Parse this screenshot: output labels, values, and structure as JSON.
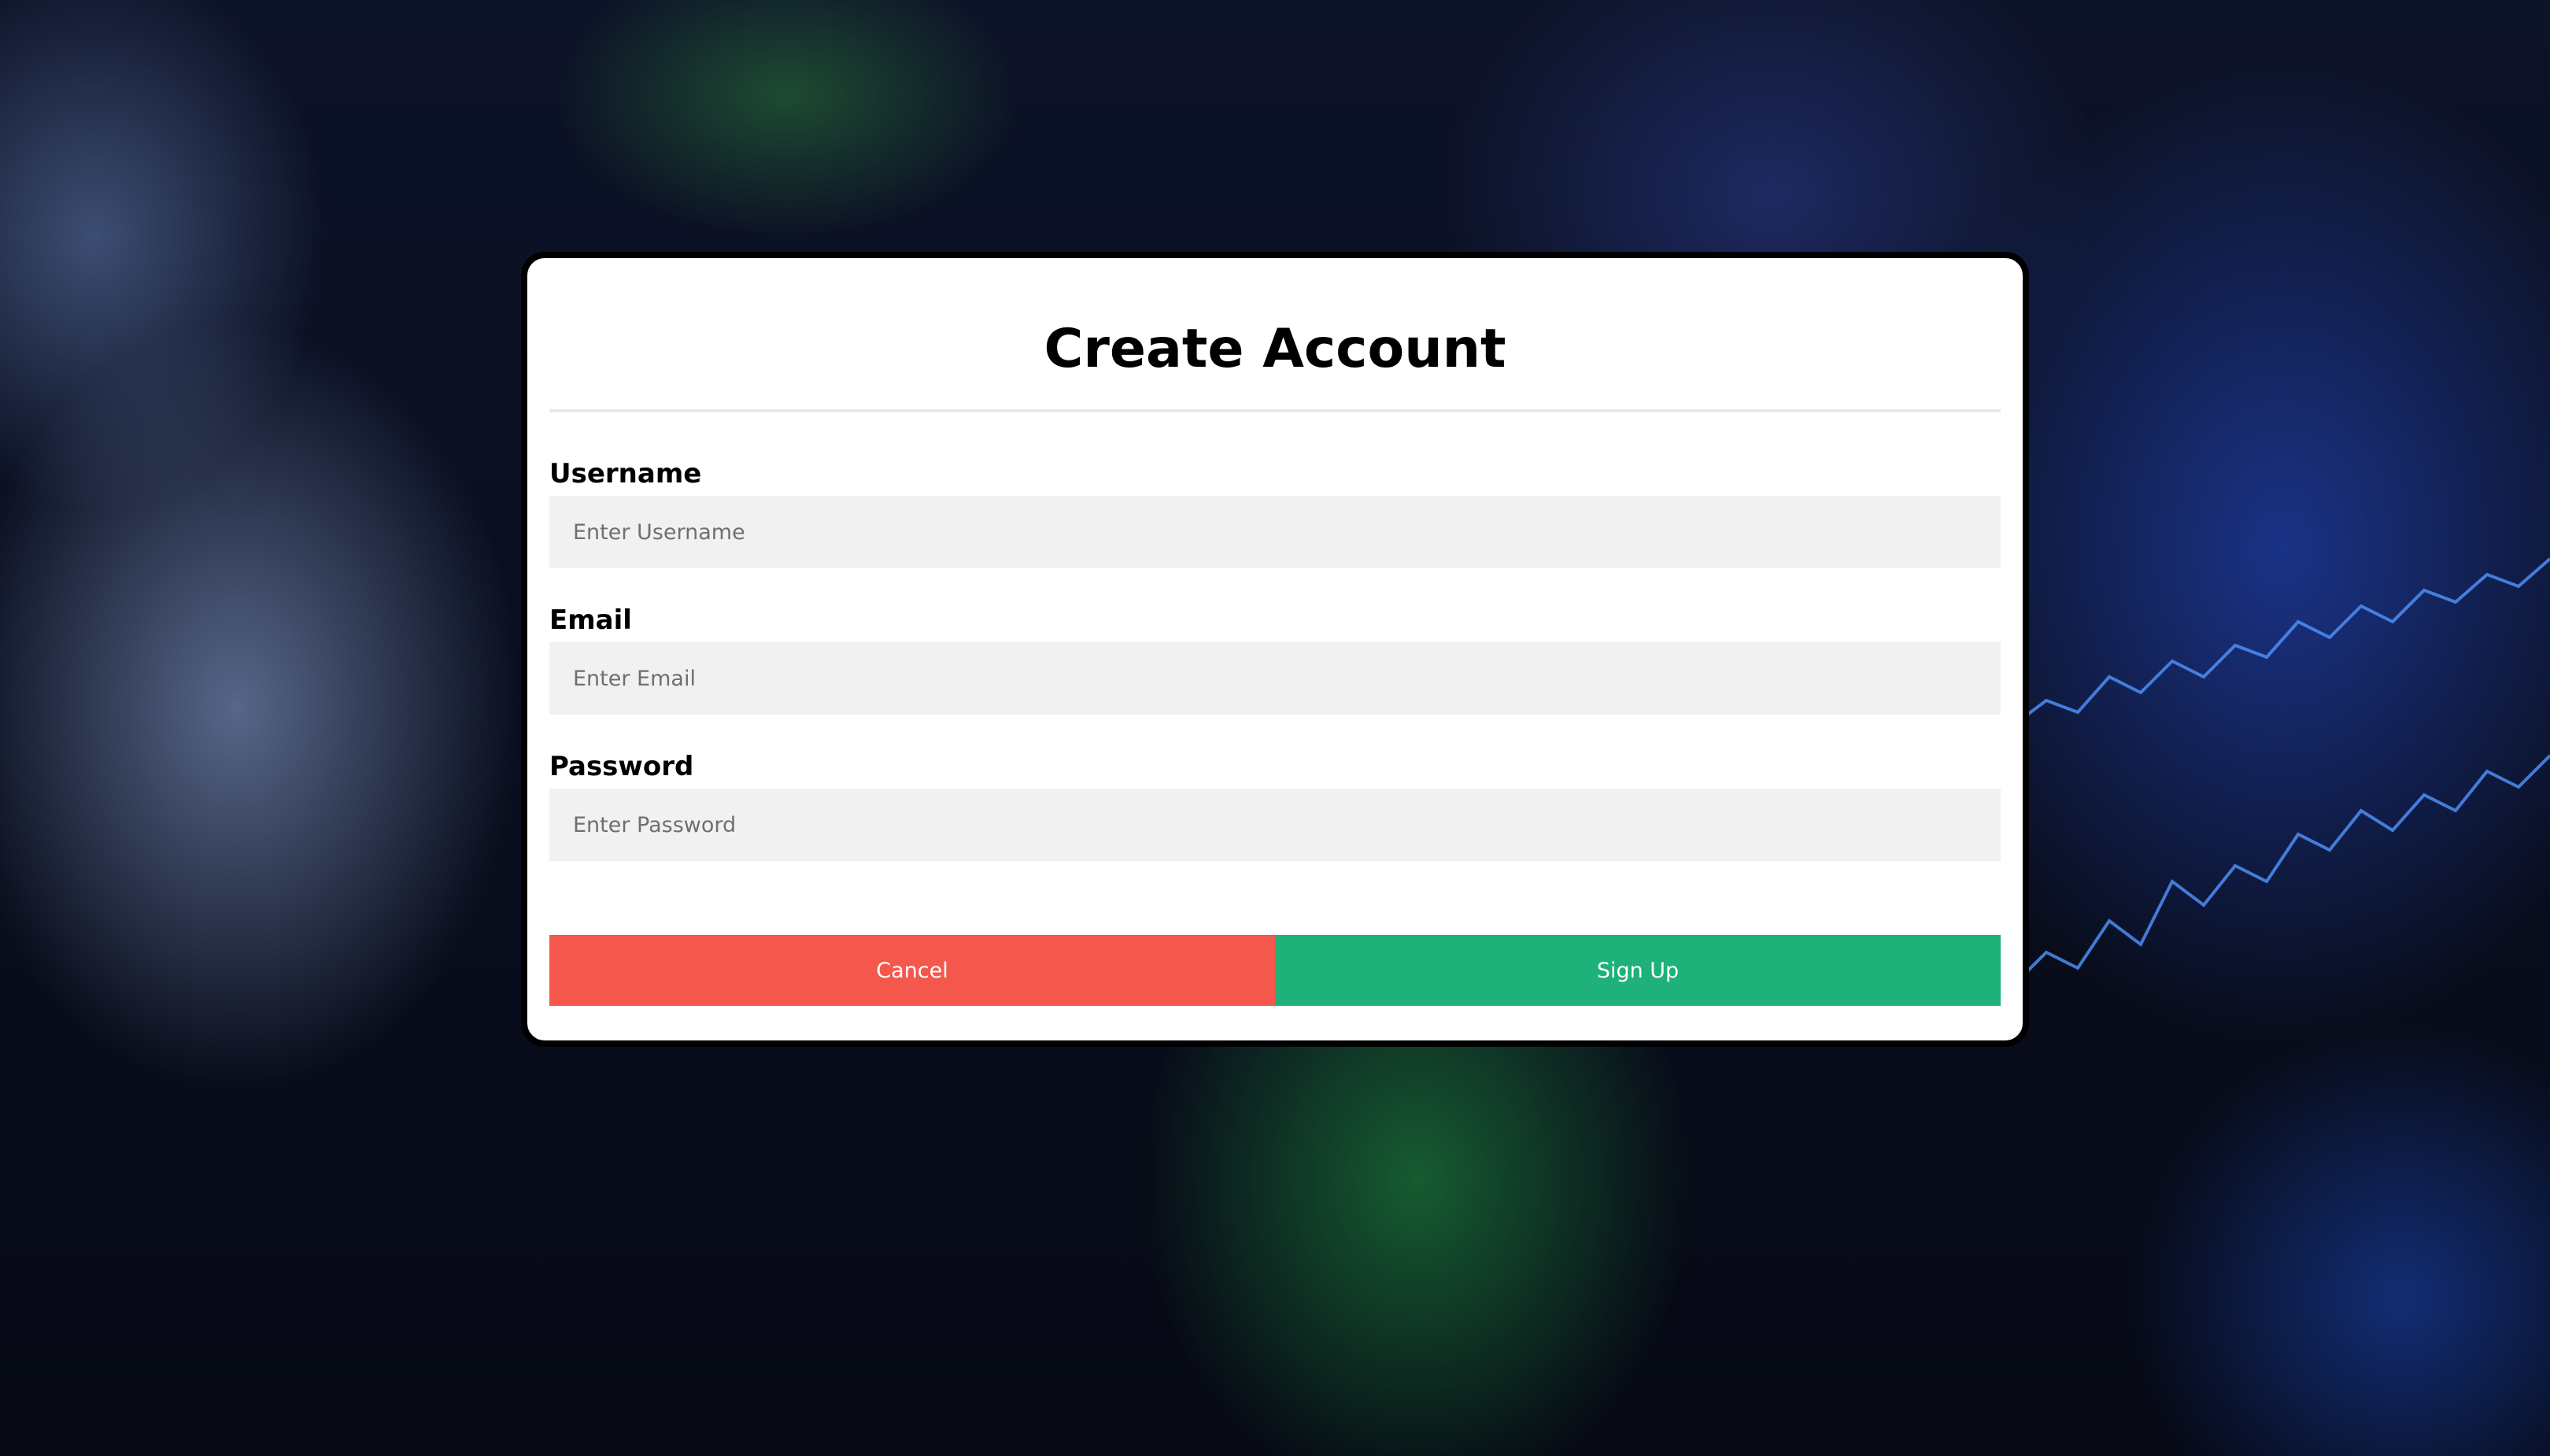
{
  "form": {
    "title": "Create Account",
    "fields": [
      {
        "label": "Username",
        "placeholder": "Enter Username"
      },
      {
        "label": "Email",
        "placeholder": "Enter Email"
      },
      {
        "label": "Password",
        "placeholder": "Enter Password"
      }
    ],
    "buttons": {
      "cancel_label": "Cancel",
      "signup_label": "Sign Up"
    }
  },
  "colors": {
    "cancel_button": "#f4584c",
    "signup_button": "#1eb17a",
    "input_background": "#f1f1f1",
    "modal_border": "#000000"
  }
}
